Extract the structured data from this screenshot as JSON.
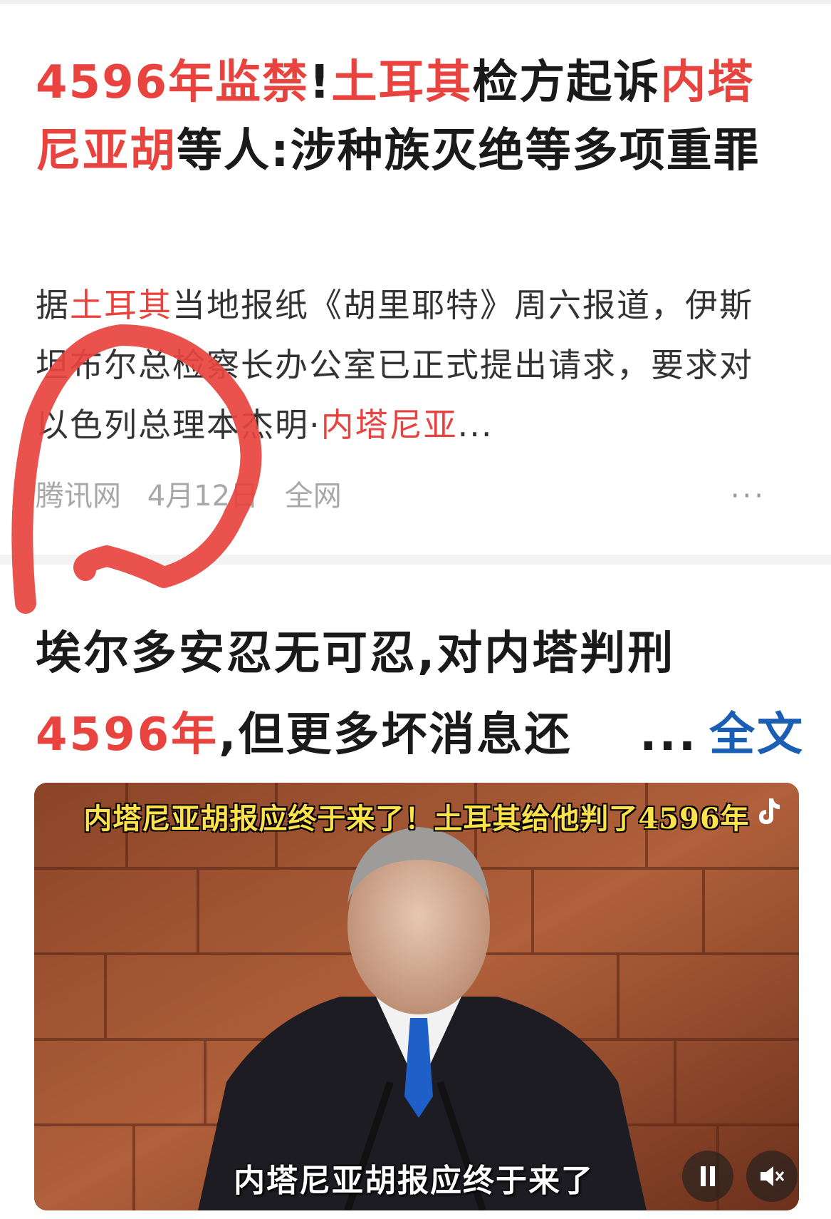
{
  "article1": {
    "title_parts": [
      {
        "text": "4596年监禁",
        "highlight": true
      },
      {
        "text": "!",
        "highlight": false
      },
      {
        "text": "土耳其",
        "highlight": true
      },
      {
        "text": "检方起诉",
        "highlight": false
      },
      {
        "text": "内塔尼亚胡",
        "highlight": true
      },
      {
        "text": "等人:涉种族灭绝等多项重罪",
        "highlight": false
      }
    ],
    "snippet_parts": [
      {
        "text": "据",
        "highlight": false
      },
      {
        "text": "土耳其",
        "highlight": true
      },
      {
        "text": "当地报纸《胡里耶特》周六报道，伊斯坦布尔总检察长办公室已正式提出请求，要求对以色列总理本杰明·",
        "highlight": false
      },
      {
        "text": "内塔尼亚",
        "highlight": true
      },
      {
        "text": "...",
        "highlight": false
      }
    ],
    "source": "腾讯网",
    "date": "4月12日",
    "scope": "全网",
    "more": "···"
  },
  "article2": {
    "title_line1": "埃尔多安忍无可忍,对内塔判刑",
    "title_line2_highlight": "4596年",
    "title_line2_rest": ",但更多坏消息还",
    "ellipsis": "...",
    "fulltext_link": "全文",
    "video": {
      "caption_top": "内塔尼亚胡报应终于来了！土耳其给他判了4596年",
      "caption_bottom": "内塔尼亚胡报应终于来了"
    }
  },
  "colors": {
    "highlight": "#e8433e",
    "link": "#1a5fb4",
    "annotation_red": "#e8433e",
    "caption_yellow": "#ffe14a"
  },
  "icons": [
    "more-icon",
    "tiktok-icon",
    "pause-icon",
    "mute-icon"
  ]
}
